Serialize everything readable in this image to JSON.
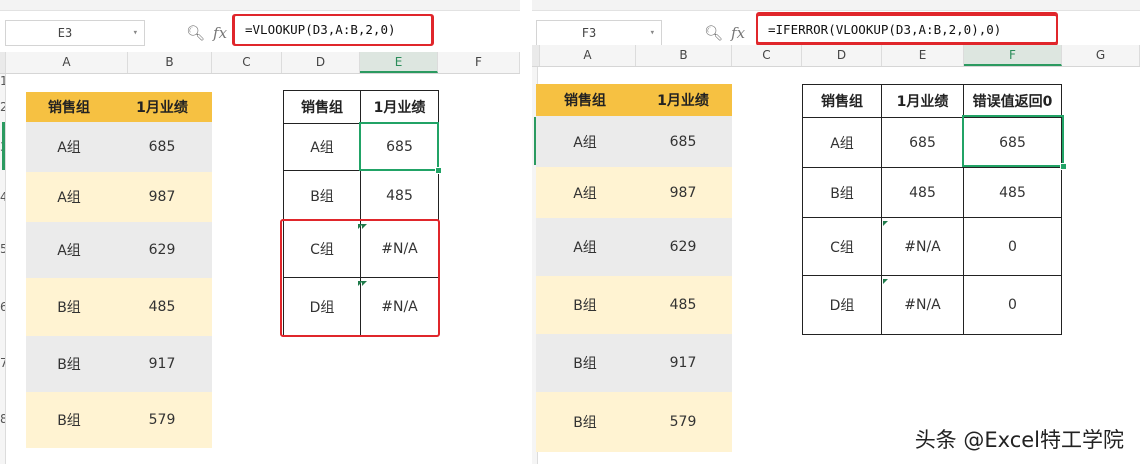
{
  "left": {
    "name_box": "E3",
    "formula": "=VLOOKUP(D3,A:B,2,0)",
    "columns": [
      "A",
      "B",
      "C",
      "D",
      "E",
      "F"
    ],
    "active_column": "E",
    "row_numbers": [
      "1",
      "2",
      "3",
      "4",
      "5",
      "6",
      "7",
      "8"
    ],
    "source_headers": [
      "销售组",
      "1月业绩"
    ],
    "source_rows": [
      [
        "A组",
        "685"
      ],
      [
        "A组",
        "987"
      ],
      [
        "A组",
        "629"
      ],
      [
        "B组",
        "485"
      ],
      [
        "B组",
        "917"
      ],
      [
        "B组",
        "579"
      ]
    ],
    "lookup_headers": [
      "销售组",
      "1月业绩"
    ],
    "lookup_rows": [
      [
        "A组",
        "685"
      ],
      [
        "B组",
        "485"
      ],
      [
        "C组",
        "#N/A"
      ],
      [
        "D组",
        "#N/A"
      ]
    ]
  },
  "right": {
    "name_box": "F3",
    "formula": "=IFERROR(VLOOKUP(D3,A:B,2,0),0)",
    "columns": [
      "A",
      "B",
      "C",
      "D",
      "E",
      "F",
      "G"
    ],
    "active_column": "F",
    "source_headers": [
      "销售组",
      "1月业绩"
    ],
    "source_rows": [
      [
        "A组",
        "685"
      ],
      [
        "A组",
        "987"
      ],
      [
        "A组",
        "629"
      ],
      [
        "B组",
        "485"
      ],
      [
        "B组",
        "917"
      ],
      [
        "B组",
        "579"
      ]
    ],
    "lookup_headers": [
      "销售组",
      "1月业绩",
      "错误值返回0"
    ],
    "lookup_rows": [
      [
        "A组",
        "685",
        "685"
      ],
      [
        "B组",
        "485",
        "485"
      ],
      [
        "C组",
        "#N/A",
        "0"
      ],
      [
        "D组",
        "#N/A",
        "0"
      ]
    ]
  },
  "icons": {
    "zoom": "magnifier-icon",
    "fx": "fx-icon",
    "dropdown": "chevron-down-icon"
  },
  "colors": {
    "header": "#f6c142",
    "band_a": "#ebebeb",
    "band_b": "#fff3d2",
    "highlight": "#e0262b",
    "selection": "#21a366"
  },
  "watermark": "头条 @Excel特工学院"
}
